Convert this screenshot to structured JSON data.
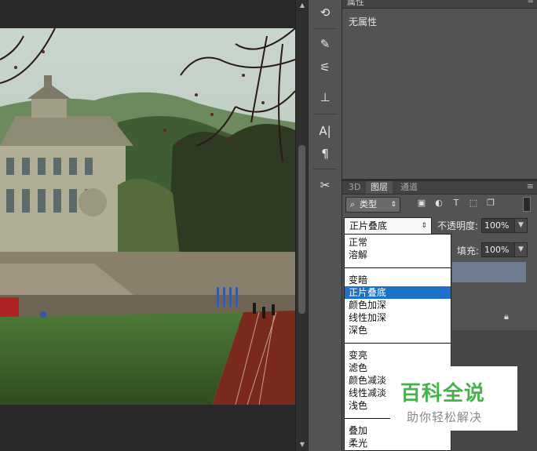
{
  "colors": {
    "ui_dark": "#282828",
    "panel": "#535353",
    "selection": "#1a73c9",
    "watermark_green": "#44b34a"
  },
  "toolstrip": {
    "icons": [
      "history-brush-icon",
      "brush-icon",
      "adjust-icon",
      "stamp-icon",
      "character-icon",
      "paragraph-icon",
      "tools-icon"
    ]
  },
  "properties": {
    "tab_label": "属性",
    "empty_text": "无属性"
  },
  "layers": {
    "tabs": [
      "3D",
      "图层",
      "通道"
    ],
    "active_tab": "图层",
    "filter_label": "类型",
    "blend_mode": "正片叠底",
    "opacity_label": "不透明度:",
    "opacity_value": "100%",
    "fill_label": "填充:",
    "fill_value": "100%"
  },
  "blend_dropdown": {
    "selected": "正片叠底",
    "groups": [
      [
        "正常",
        "溶解"
      ],
      [
        "变暗",
        "正片叠底",
        "颜色加深",
        "线性加深",
        "深色"
      ],
      [
        "变亮",
        "滤色",
        "颜色减淡",
        "线性减淡",
        "浅色"
      ],
      [
        "叠加",
        "柔光"
      ]
    ]
  },
  "watermark": {
    "title": "百科全说",
    "subtitle": "助你轻松解决"
  }
}
